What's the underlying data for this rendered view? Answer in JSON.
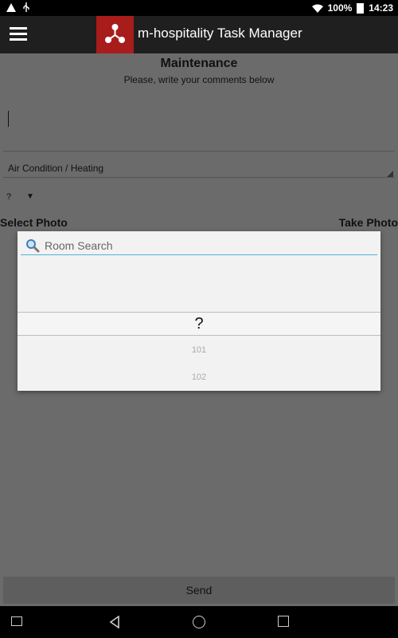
{
  "status_bar": {
    "battery_percent": "100%",
    "time": "14:23"
  },
  "app_bar": {
    "title": "m-hospitality Task Manager"
  },
  "form": {
    "heading": "Maintenance",
    "subheading": "Please, write your comments below",
    "comment_value": "",
    "category_value": "Air Condition / Heating",
    "room_value": "?",
    "select_photo_label": "Select Photo",
    "take_photo_label": "Take Photo",
    "send_label": "Send"
  },
  "room_dialog": {
    "search_placeholder": "Room Search",
    "selected_value": "?",
    "items": [
      "101",
      "102"
    ]
  }
}
